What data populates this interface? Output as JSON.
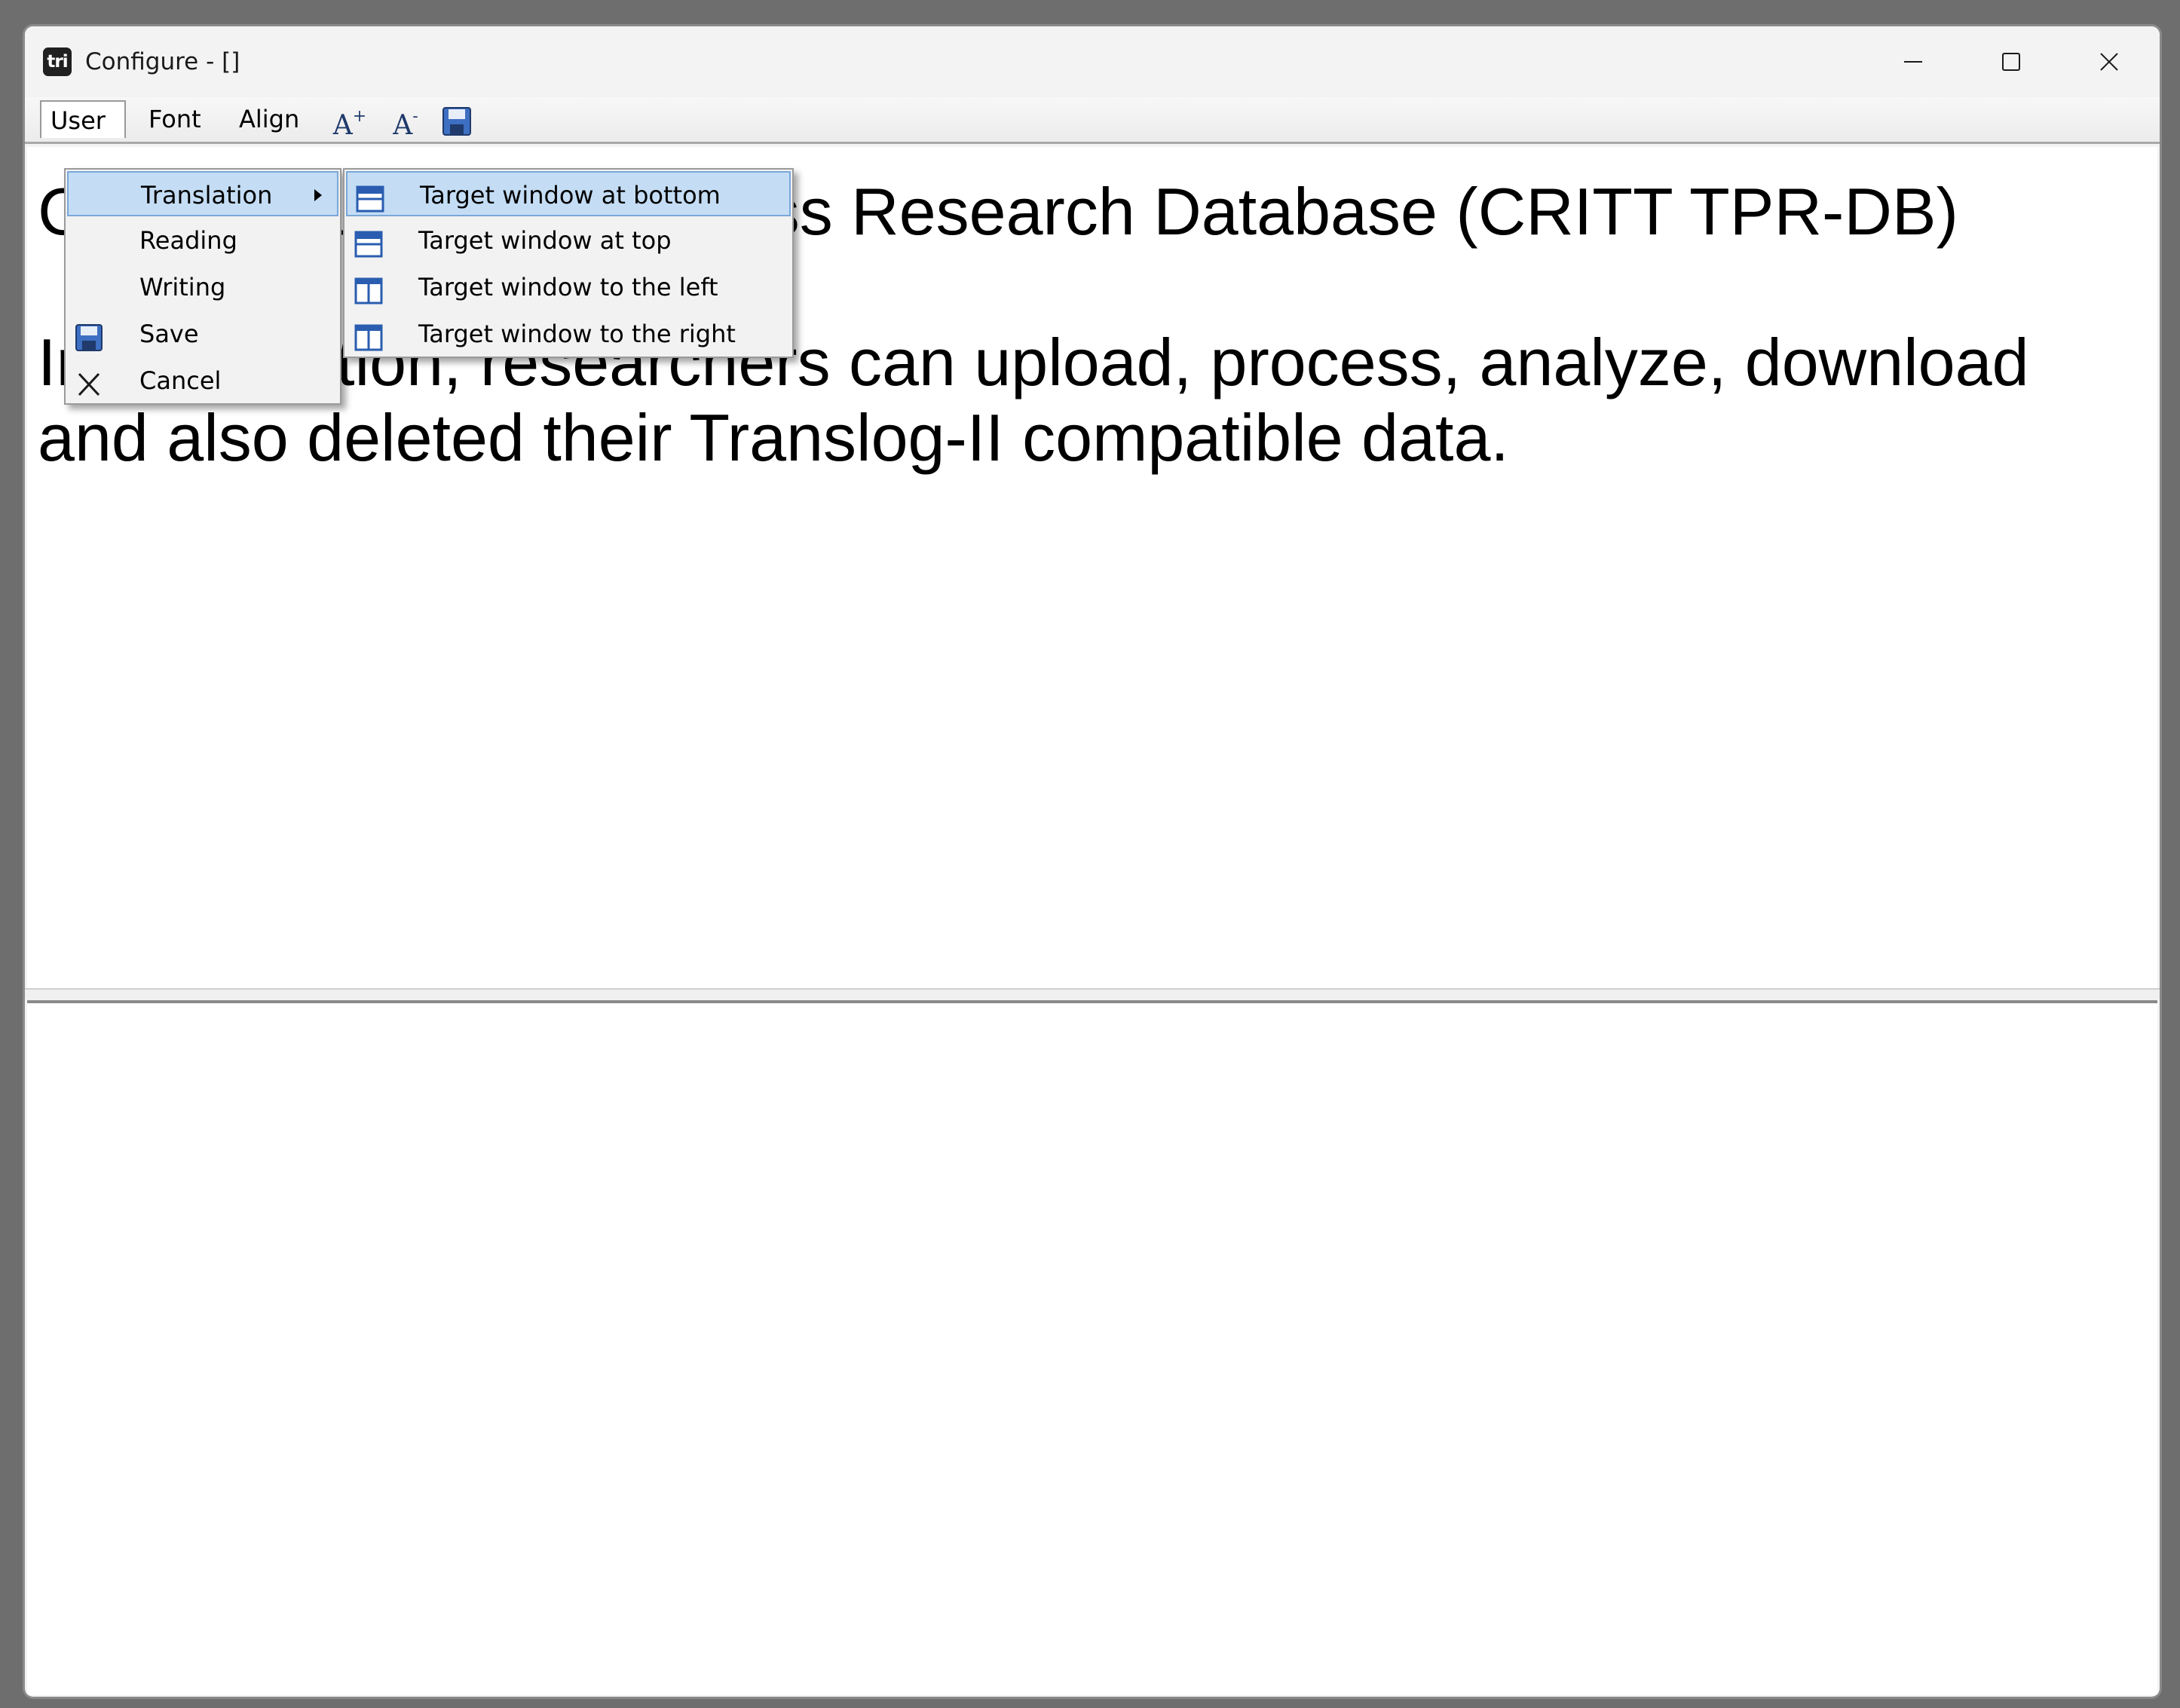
{
  "window": {
    "title": "Configure - []",
    "app_icon": "tri"
  },
  "window_controls": {
    "minimize_icon": "minimize-icon",
    "maximize_icon": "maximize-icon",
    "close_icon": "close-icon"
  },
  "menubar": {
    "items": [
      {
        "label": "User",
        "open": true
      },
      {
        "label": "Font"
      },
      {
        "label": "Align"
      }
    ],
    "toolbar_icons": [
      {
        "icon": "font-increase-icon",
        "glyph": "A",
        "mark": "+"
      },
      {
        "icon": "font-decrease-icon",
        "glyph": "A",
        "mark": "-"
      },
      {
        "icon": "save-icon"
      }
    ]
  },
  "user_menu": {
    "items": [
      {
        "label": "Translation",
        "highlighted": true,
        "has_submenu": true
      },
      {
        "label": "Reading"
      },
      {
        "label": "Writing"
      },
      {
        "label": "Save",
        "icon": "save-icon"
      },
      {
        "label": "Cancel",
        "icon": "cancel-icon"
      }
    ]
  },
  "translation_submenu": {
    "items": [
      {
        "label": "Target window at bottom",
        "icon": "layout-horizontal-icon",
        "highlighted": true
      },
      {
        "label": "Target window at top",
        "icon": "layout-horizontal-icon"
      },
      {
        "label": "Target window to the left",
        "icon": "layout-vertical-icon"
      },
      {
        "label": "Target window to the right",
        "icon": "layout-vertical-icon"
      }
    ]
  },
  "source_pane": {
    "paragraph_1": "CRITT Translation Process Research Database (CRITT TPR-DB)",
    "paragraph_2": "In this section, researchers can upload, process, analyze, download and also deleted their Translog-II compatible data."
  },
  "target_pane": {
    "text": ""
  },
  "colors": {
    "menu_highlight": "#c4ddf5",
    "menu_highlight_border": "#7aa7d8",
    "toolbar_icon": "#1f3a6b"
  }
}
